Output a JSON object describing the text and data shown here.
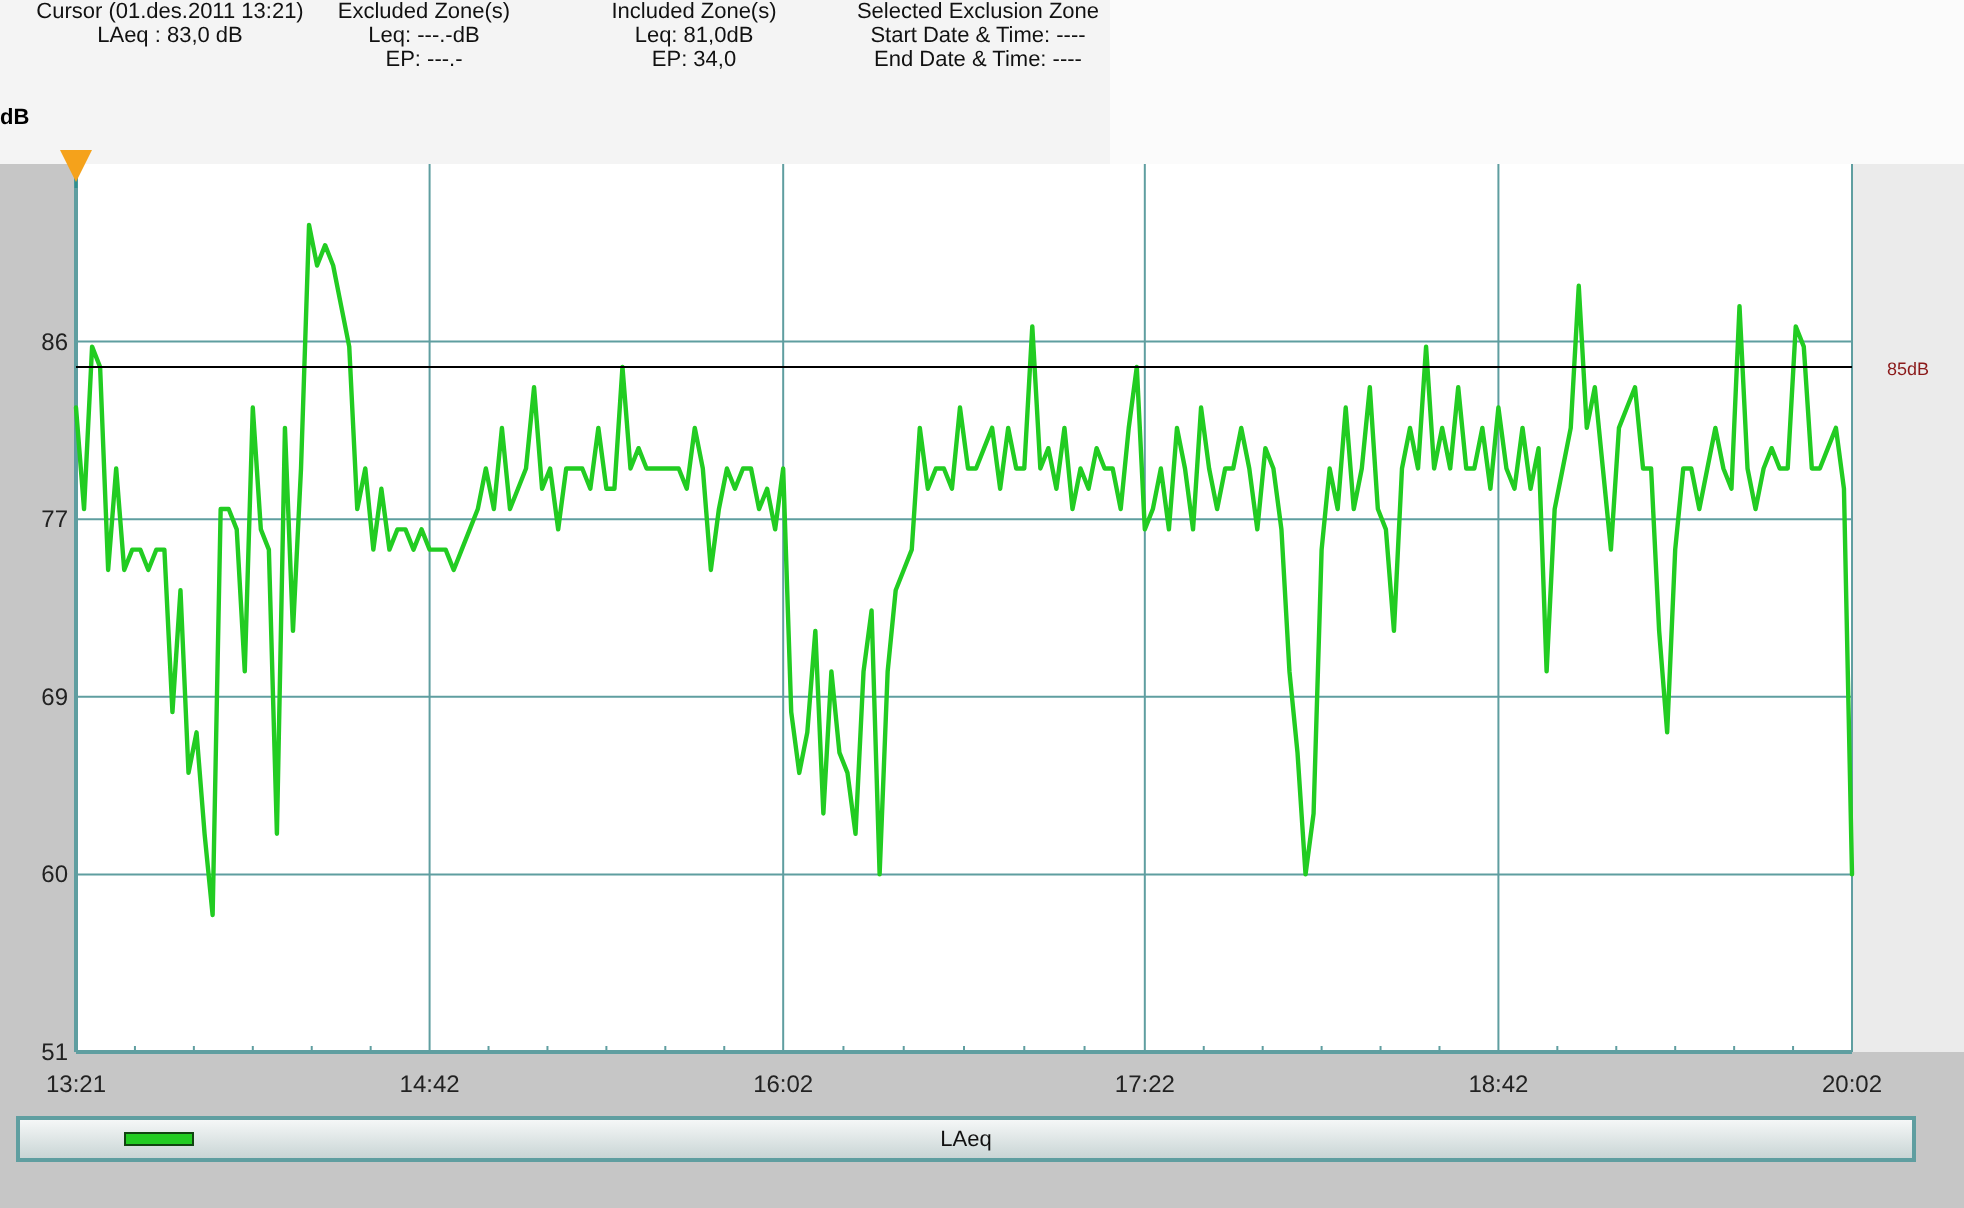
{
  "info_panel": {
    "columns": [
      {
        "title": "Cursor (01.des.2011 13:21)",
        "lines": [
          "LAeq : 83,0 dB"
        ]
      },
      {
        "title": "Excluded Zone(s)",
        "lines": [
          "Leq: ---.-dB",
          "EP: ---.-"
        ]
      },
      {
        "title": "Included Zone(s)",
        "lines": [
          "Leq: 81,0dB",
          "EP: 34,0"
        ]
      },
      {
        "title": "Selected Exclusion Zone",
        "lines": [
          "Start Date & Time: ----",
          "End Date & Time: ----"
        ]
      }
    ]
  },
  "chart": {
    "chart_data": {
      "type": "line",
      "ylabel": "dB",
      "categories": [
        "13:21",
        null,
        null,
        null,
        null,
        null,
        null,
        null,
        null,
        null,
        null,
        null,
        null,
        null,
        null,
        null,
        null,
        null,
        null,
        null,
        null,
        null,
        null,
        null,
        null,
        null,
        null,
        null,
        null,
        null,
        null,
        null,
        null,
        null,
        null,
        null,
        null,
        null,
        null,
        null,
        null,
        null,
        null,
        null,
        "14:42",
        null,
        null,
        null,
        null,
        null,
        null,
        null,
        null,
        null,
        null,
        null,
        null,
        null,
        null,
        null,
        null,
        null,
        null,
        null,
        null,
        null,
        null,
        null,
        null,
        null,
        null,
        null,
        null,
        null,
        null,
        null,
        null,
        null,
        null,
        null,
        null,
        null,
        null,
        null,
        null,
        null,
        null,
        null,
        "16:02",
        null,
        null,
        null,
        null,
        null,
        null,
        null,
        null,
        null,
        null,
        null,
        null,
        null,
        null,
        null,
        null,
        null,
        null,
        null,
        null,
        null,
        null,
        null,
        null,
        null,
        null,
        null,
        null,
        null,
        null,
        null,
        null,
        null,
        null,
        null,
        null,
        null,
        null,
        null,
        null,
        null,
        null,
        null,
        null,
        "17:22",
        null,
        null,
        null,
        null,
        null,
        null,
        null,
        null,
        null,
        null,
        null,
        null,
        null,
        null,
        null,
        null,
        null,
        null,
        null,
        null,
        null,
        null,
        null,
        null,
        null,
        null,
        null,
        null,
        null,
        null,
        null,
        null,
        null,
        null,
        null,
        null,
        null,
        null,
        null,
        null,
        null,
        null,
        null,
        "18:42",
        null,
        null,
        null,
        null,
        null,
        null,
        null,
        null,
        null,
        null,
        null,
        null,
        null,
        null,
        null,
        null,
        null,
        null,
        null,
        null,
        null,
        null,
        null,
        null,
        null,
        null,
        null,
        null,
        null,
        null,
        null,
        null,
        null,
        null,
        null,
        null,
        null,
        null,
        null,
        null,
        null,
        null,
        null,
        "20:02"
      ],
      "series": [
        {
          "name": "LAeq",
          "color": "#22cc22",
          "values": [
            83,
            78,
            86,
            85,
            75,
            80,
            75,
            76,
            76,
            75,
            76,
            76,
            68,
            74,
            65,
            67,
            62,
            58,
            78,
            78,
            77,
            70,
            83,
            77,
            76,
            62,
            82,
            72,
            80,
            92,
            90,
            91,
            90,
            88,
            86,
            78,
            80,
            76,
            79,
            76,
            77,
            77,
            76,
            77,
            76,
            76,
            76,
            75,
            76,
            77,
            78,
            80,
            78,
            82,
            78,
            79,
            80,
            84,
            79,
            80,
            77,
            80,
            80,
            80,
            79,
            82,
            79,
            79,
            85,
            80,
            81,
            80,
            80,
            80,
            80,
            80,
            79,
            82,
            80,
            75,
            78,
            80,
            79,
            80,
            80,
            78,
            79,
            77,
            80,
            68,
            65,
            67,
            72,
            63,
            70,
            66,
            65,
            62,
            70,
            73,
            60,
            70,
            74,
            75,
            76,
            82,
            79,
            80,
            80,
            79,
            83,
            80,
            80,
            81,
            82,
            79,
            82,
            80,
            80,
            87,
            80,
            81,
            79,
            82,
            78,
            80,
            79,
            81,
            80,
            80,
            78,
            82,
            85,
            77,
            78,
            80,
            77,
            82,
            80,
            77,
            83,
            80,
            78,
            80,
            80,
            82,
            80,
            77,
            81,
            80,
            77,
            70,
            66,
            60,
            63,
            76,
            80,
            78,
            83,
            78,
            80,
            84,
            78,
            77,
            72,
            80,
            82,
            80,
            86,
            80,
            82,
            80,
            84,
            80,
            80,
            82,
            79,
            83,
            80,
            79,
            82,
            79,
            81,
            70,
            78,
            80,
            82,
            89,
            82,
            84,
            80,
            76,
            82,
            83,
            84,
            80,
            80,
            72,
            67,
            76,
            80,
            80,
            78,
            80,
            82,
            80,
            79,
            88,
            80,
            78,
            80,
            81,
            80,
            80,
            87,
            86,
            80,
            80,
            81,
            82,
            79,
            60
          ]
        }
      ],
      "ylim": [
        51.25,
        95
      ],
      "yticks": [
        {
          "value": 51.25,
          "label": "51"
        },
        {
          "value": 60,
          "label": "60"
        },
        {
          "value": 68.75,
          "label": "69"
        },
        {
          "value": 77.5,
          "label": "77"
        },
        {
          "value": 86.25,
          "label": "86"
        }
      ],
      "grid": true,
      "ref_lines": [
        {
          "axis": "y",
          "value": 85,
          "label": "85dB"
        }
      ]
    }
  }
}
